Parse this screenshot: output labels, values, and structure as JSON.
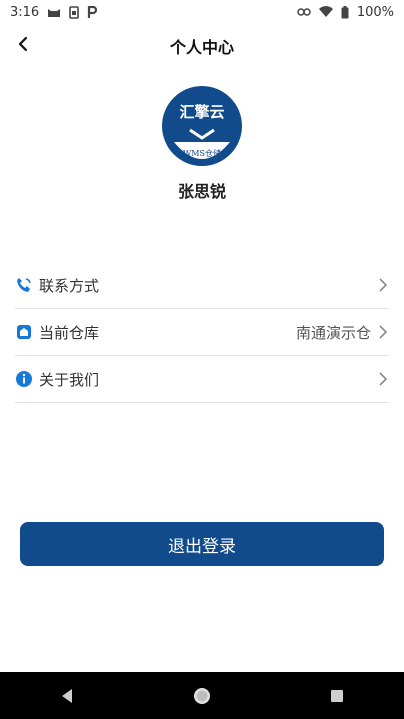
{
  "status_bar": {
    "time": "3:16",
    "battery_text": "100%",
    "icons_left": [
      "cat-icon",
      "sim-card-icon",
      "p-icon"
    ],
    "icons_right": [
      "link-icon",
      "wifi-icon",
      "battery-icon"
    ]
  },
  "header": {
    "title": "个人中心",
    "back_icon": "chevron-left-icon"
  },
  "profile": {
    "logo_text": "汇擎云",
    "logo_subtext": "WMS仓储",
    "name": "张思锐"
  },
  "menu": {
    "items": [
      {
        "icon": "phone-icon",
        "label": "联系方式",
        "value": ""
      },
      {
        "icon": "warehouse-icon",
        "label": "当前仓库",
        "value": "南通演示仓"
      },
      {
        "icon": "info-icon",
        "label": "关于我们",
        "value": ""
      }
    ]
  },
  "logout": {
    "label": "退出登录"
  },
  "colors": {
    "accent": "#124b8c",
    "icon_blue": "#1679d8",
    "divider": "#e3e3e3"
  },
  "nav": [
    "back-triangle-icon",
    "home-circle-icon",
    "recents-square-icon"
  ]
}
